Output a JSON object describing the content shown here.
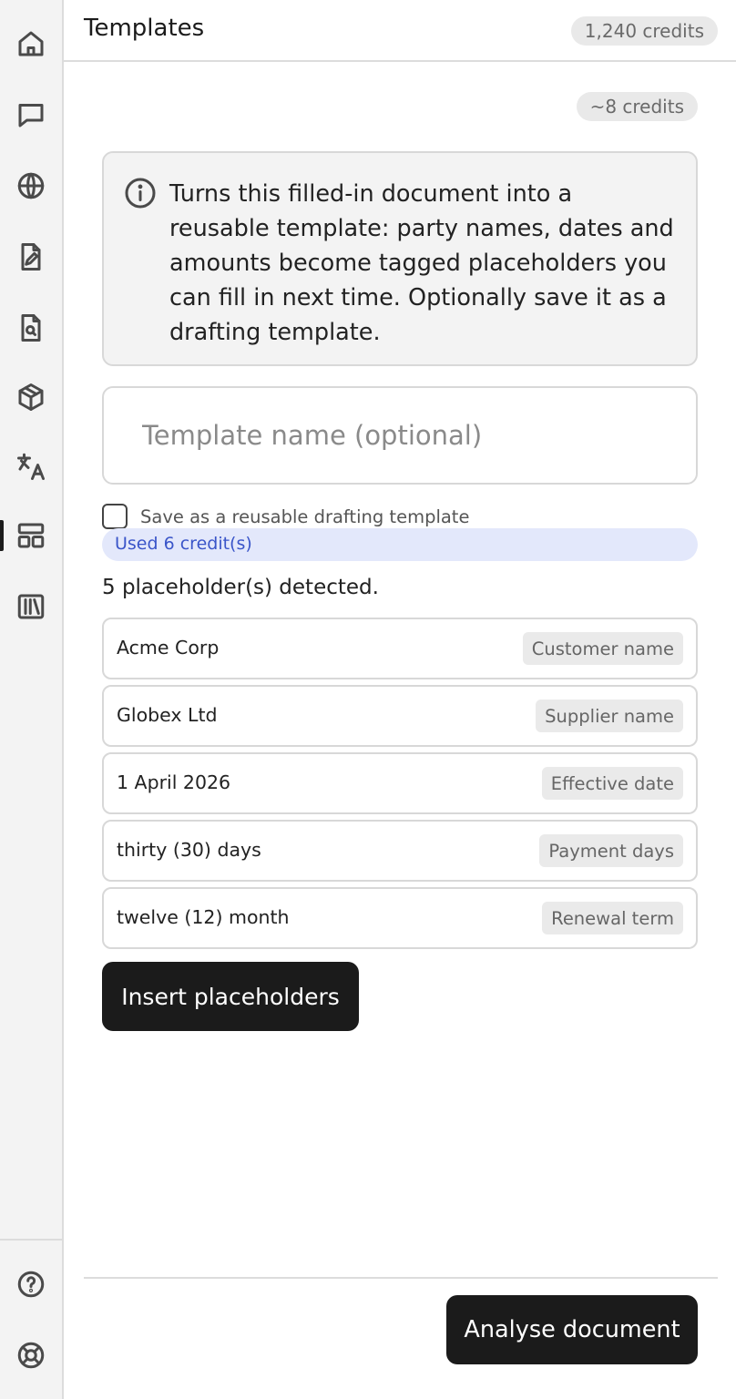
{
  "header": {
    "title": "Templates",
    "credits_badge": "1,240 credits"
  },
  "sidebar": {
    "items": [
      {
        "icon": "home-icon"
      },
      {
        "icon": "chat-icon"
      },
      {
        "icon": "globe-icon"
      },
      {
        "icon": "document-edit-icon"
      },
      {
        "icon": "document-search-icon"
      },
      {
        "icon": "cube-icon"
      },
      {
        "icon": "translate-icon"
      },
      {
        "icon": "templates-icon",
        "active": true
      },
      {
        "icon": "library-icon"
      }
    ],
    "bottom_items": [
      {
        "icon": "help-icon"
      },
      {
        "icon": "support-icon"
      }
    ]
  },
  "main": {
    "cost_estimate": "~8 credits",
    "info_text": "Turns this filled-in document into a reusable template: party names, dates and amounts become tagged placeholders you can fill in next time. Optionally save it as a drafting template.",
    "template_name": {
      "value": "",
      "placeholder": "Template name (optional)"
    },
    "save_checkbox": {
      "label": "Save as a reusable drafting template",
      "checked": false
    },
    "used_credits": "Used 6 credit(s)",
    "detected_text": "5 placeholder(s) detected.",
    "placeholders": [
      {
        "value": "Acme Corp",
        "tag": "Customer name"
      },
      {
        "value": "Globex Ltd",
        "tag": "Supplier name"
      },
      {
        "value": "1 April 2026",
        "tag": "Effective date"
      },
      {
        "value": "thirty (30) days",
        "tag": "Payment days"
      },
      {
        "value": "twelve (12) month",
        "tag": "Renewal term"
      }
    ],
    "insert_button": "Insert placeholders",
    "analyse_button": "Analyse document"
  },
  "colors": {
    "primary_button": "#1b1b1b",
    "info_badge_bg": "#e3e8fb",
    "info_badge_text": "#3a55c9"
  }
}
